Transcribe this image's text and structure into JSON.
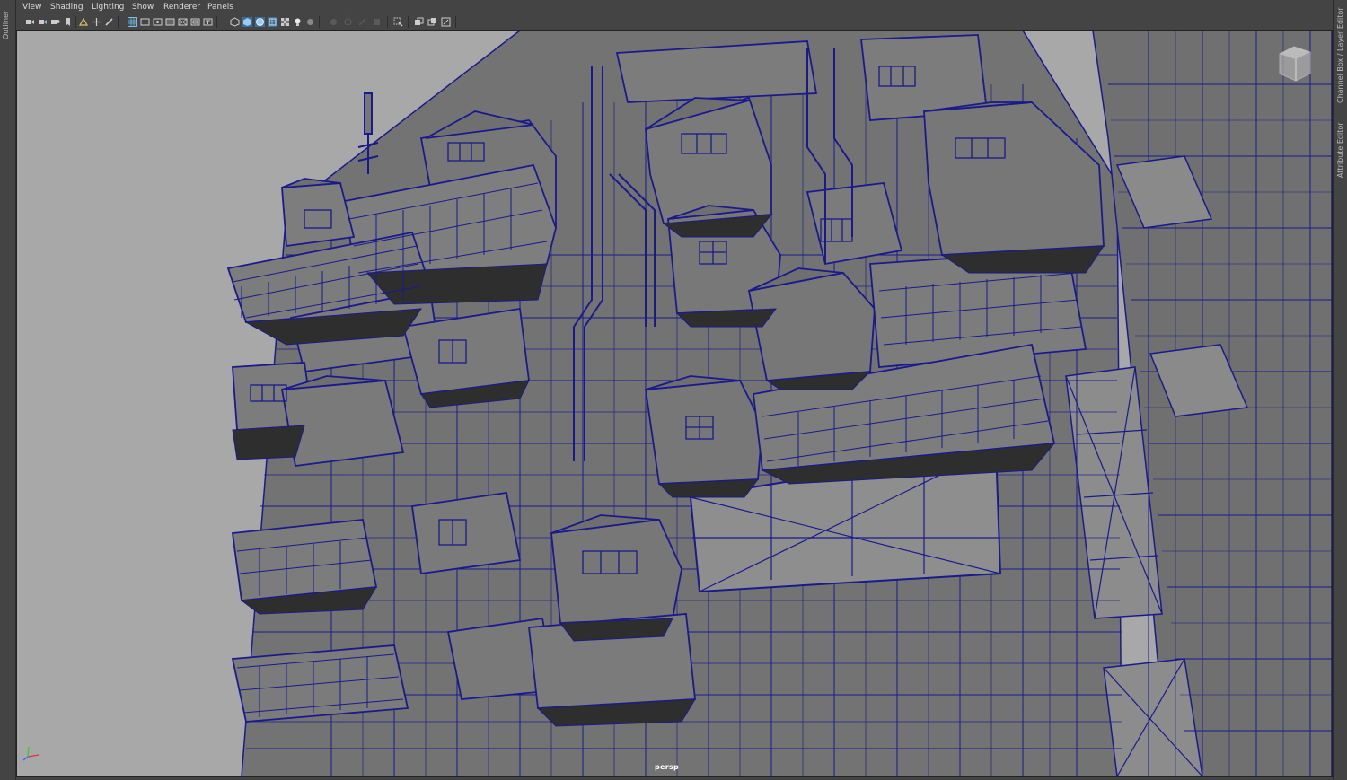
{
  "panels": {
    "left_tab": "Outliner",
    "right_tabs": [
      "Channel Box / Layer Editor",
      "Attribute Editor"
    ]
  },
  "menu": {
    "items": [
      "View",
      "Shading",
      "Lighting",
      "Show",
      "Renderer",
      "Panels"
    ]
  },
  "toolbar": {
    "icons": [
      "camera-icon",
      "camera-attributes-icon",
      "bookmark-camera-icon",
      "bookmark-icon",
      "image-plane-icon",
      "2d-pan-zoom-icon",
      "grease-pencil-icon",
      "grid-icon",
      "film-gate-icon",
      "resolution-gate-icon",
      "gate-mask-icon",
      "field-chart-icon",
      "safe-action-icon",
      "safe-title-icon",
      "wireframe-icon",
      "smooth-shade-icon",
      "wireframe-on-shaded-icon",
      "xray-icon",
      "use-default-material-icon",
      "lights-icon",
      "shadows-icon",
      "ambient-occlusion-icon",
      "motion-blur-icon",
      "antialias-icon",
      "depth-of-field-icon",
      "isolate-select-icon",
      "xray-joints-icon",
      "xray-active-icon",
      "frame-all-icon"
    ]
  },
  "viewport": {
    "camera_label": "persp",
    "wire_color": "#1a1a8c",
    "background_color": "#a8a8a8",
    "surface_color": "#7a7a7a"
  }
}
